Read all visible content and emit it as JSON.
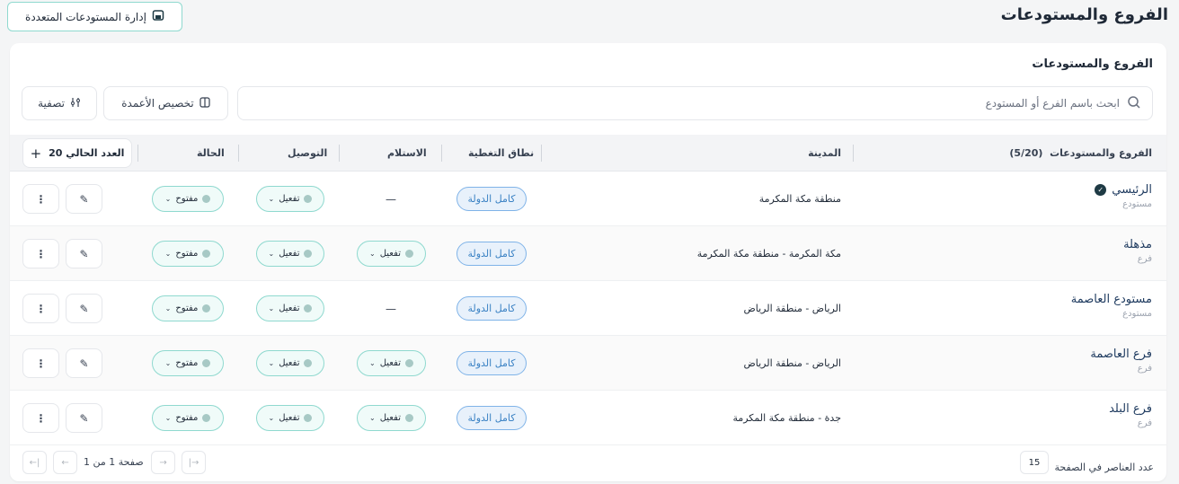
{
  "header": {
    "title": "الفروع والمستودعات",
    "multi_warehouse_label": "إدارة المستودعات المتعددة"
  },
  "card": {
    "title": "الفروع والمستودعات",
    "search_placeholder": "ابحث باسم الفرع أو المستودع",
    "customize_columns_label": "تخصيص الأعمدة",
    "filter_label": "تصفية"
  },
  "table": {
    "columns": {
      "name": "الفروع والمستودعات",
      "name_count": "(5/20)",
      "city": "المدينة",
      "coverage": "نطاق التغطية",
      "receive": "الاستلام",
      "delivery": "التوصيل",
      "status": "الحالة",
      "current_count": "العدد الحالي 20"
    },
    "rows": [
      {
        "name": "الرئيسي",
        "type": "مستودع",
        "city": "منطقة مكة المكرمة",
        "coverage": "كامل الدولة",
        "receive": "—",
        "delivery": "تفعيل",
        "status": "مفتوح",
        "primary": true
      },
      {
        "name": "مذهلة",
        "type": "فرع",
        "city": "مكة المكرمة - منطقة مكة المكرمة",
        "coverage": "كامل الدولة",
        "receive": "تفعيل",
        "delivery": "تفعيل",
        "status": "مفتوح",
        "primary": false
      },
      {
        "name": "مستودع العاصمة",
        "type": "مستودع",
        "city": "الرياض - منطقة الرياض",
        "coverage": "كامل الدولة",
        "receive": "—",
        "delivery": "تفعيل",
        "status": "مفتوح",
        "primary": false
      },
      {
        "name": "فرع العاصمة",
        "type": "فرع",
        "city": "الرياض - منطقة الرياض",
        "coverage": "كامل الدولة",
        "receive": "تفعيل",
        "delivery": "تفعيل",
        "status": "مفتوح",
        "primary": false
      },
      {
        "name": "فرع البلد",
        "type": "فرع",
        "city": "جدة - منطقة مكة المكرمة",
        "coverage": "كامل الدولة",
        "receive": "تفعيل",
        "delivery": "تفعيل",
        "status": "مفتوح",
        "primary": false
      }
    ]
  },
  "footer": {
    "per_page_label": "عدد العناصر في الصفحة",
    "per_page_value": "15",
    "page_text": "صفحة 1 من 1"
  },
  "colors": {
    "accent": "#8fd9cf",
    "coverage": "#3b82c4",
    "name_text": "#1e3a5f"
  }
}
